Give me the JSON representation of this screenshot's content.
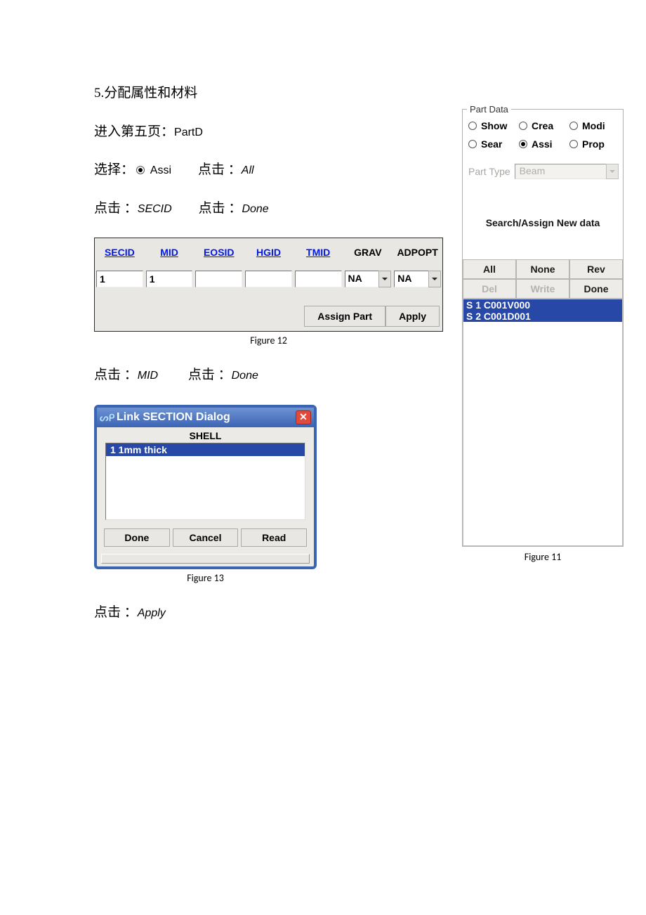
{
  "heading": "5.分配属性和材料",
  "line_enter": {
    "pre": "进入第五页：",
    "val": "PartD"
  },
  "line_select": {
    "pre": "选择：",
    "radio_label": "Assi",
    "mid": "　　点击 ：",
    "val": "All"
  },
  "line_click1": {
    "pre": "点击 ：",
    "val1": "SECID",
    "mid": "　　点击 ：",
    "val2": "Done"
  },
  "propgrid": {
    "headers_link": [
      "SECID",
      "MID",
      "EOSID",
      "HGID",
      "TMID"
    ],
    "headers_plain": [
      "GRAV",
      "ADPOPT"
    ],
    "values": {
      "secid": "1",
      "mid": "1",
      "eosid": "",
      "hgid": "",
      "tmid": "",
      "grav": "NA",
      "adpopt": "NA"
    },
    "btn_assign": "Assign Part",
    "btn_apply": "Apply"
  },
  "fig12": "Figure 12",
  "line_click2": {
    "pre": "点击 ：",
    "val1": "MID",
    "mid": "　　 点击 ：",
    "val2": "Done"
  },
  "linkdlg": {
    "title": "Link SECTION Dialog",
    "logo": "ᔕᑭ",
    "sub": "SHELL",
    "item": "1  1mm thick",
    "btn_done": "Done",
    "btn_cancel": "Cancel",
    "btn_read": "Read"
  },
  "fig13": "Figure 13",
  "line_click3": {
    "pre": "点击 ：",
    "val": "Apply"
  },
  "partdata": {
    "legend": "Part Data",
    "radios_row1": [
      "Show",
      "Crea",
      "Modi"
    ],
    "radios_row2": [
      "Sear",
      "Assi",
      "Prop"
    ],
    "selected": "Assi",
    "pt_label": "Part Type",
    "pt_value": "Beam",
    "search_title": "Search/Assign New data",
    "grid": {
      "all": "All",
      "none": "None",
      "rev": "Rev",
      "del": "Del",
      "write": "Write",
      "done": "Done"
    },
    "list": [
      "S 1 C001V000",
      "S 2 C001D001"
    ]
  },
  "fig11": "Figure 11"
}
